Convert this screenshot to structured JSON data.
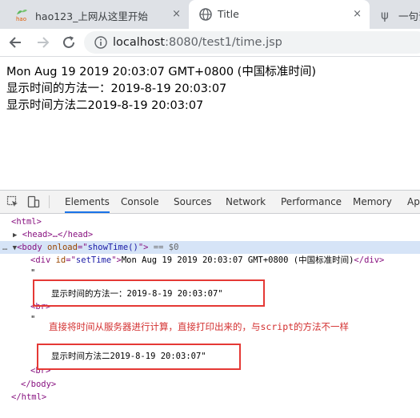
{
  "browser": {
    "tabs": [
      {
        "label": "hao123_上网从这里开始",
        "close": "×"
      },
      {
        "label": "Title",
        "close": "×"
      },
      {
        "label": "一句话"
      }
    ],
    "address": {
      "host": "localhost",
      "rest": ":8080/test1/time.jsp"
    }
  },
  "page": {
    "lines": [
      "Mon Aug 19 2019 20:03:07 GMT+0800 (中国标准时间)",
      "显示时间的方法一：2019-8-19 20:03:07",
      "显示时间方法二2019-8-19 20:03:07"
    ]
  },
  "devtools": {
    "tabs": [
      "Elements",
      "Console",
      "Sources",
      "Network",
      "Performance",
      "Memory",
      "Ap"
    ],
    "active_tab": "Elements",
    "code": {
      "html_open": "<html>",
      "head": "<head>…</head>",
      "body_prefix": "<body ",
      "body_attr": "onload",
      "body_eq": "=\"",
      "body_val": "showTime()",
      "body_close": "\">",
      "body_suffix": " == $0",
      "div_open": "<div ",
      "div_attr": "id",
      "div_eq": "=\"",
      "div_val": "setTime",
      "div_close": "\">",
      "div_text": "Mon Aug 19 2019 20:03:07 GMT+0800 (中国标准时间)",
      "div_end": "</div>",
      "quote1": "\"",
      "text1": "显示时间的方法一：2019-8-19 20:03:07\"",
      "br1": "<br>",
      "quote2": "\"",
      "text2": "显示时间方法二2019-8-19 20:03:07\"",
      "br2": "<br>",
      "body_end": "</body>",
      "html_end": "</html>"
    },
    "annotation": "直接将时间从服务器进行计算，直接打印出来的，与script的方法不一样"
  },
  "colors": {
    "annotation": "#d32f2f",
    "highlight_box": "#e53935",
    "selected_row": "#d6e4f7",
    "active_tab_underline": "#1a73e8"
  }
}
